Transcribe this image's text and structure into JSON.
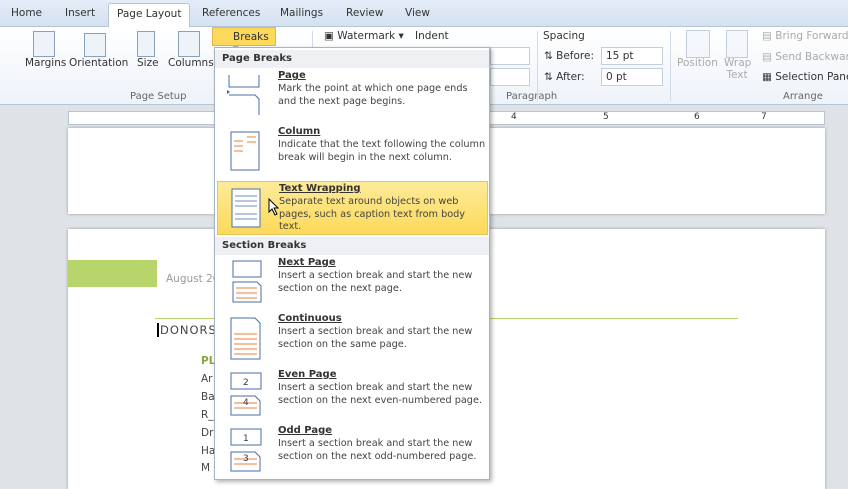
{
  "tabs": [
    "Home",
    "Insert",
    "Page Layout",
    "References",
    "Mailings",
    "Review",
    "View"
  ],
  "ribbon": {
    "margins": "Margins",
    "orientation": "Orientation",
    "size": "Size",
    "columns": "Columns",
    "page_setup": "Page Setup",
    "breaks": "Breaks",
    "watermark": "Watermark",
    "indent": "Indent",
    "spacing": "Spacing",
    "before_label": "Before:",
    "before_value": "15 pt",
    "after_label": "After:",
    "after_value": "0 pt",
    "paragraph": "Paragraph",
    "position": "Position",
    "wrap_text": "Wrap Text",
    "bring_forward": "Bring Forward",
    "send_backward": "Send Backward",
    "selection_pane": "Selection Pane",
    "arrange": "Arrange"
  },
  "ruler": [
    "4",
    "5",
    "6",
    "7"
  ],
  "menu": {
    "page_breaks": "Page Breaks",
    "section_breaks": "Section Breaks",
    "items": [
      {
        "title": "Page",
        "desc": "Mark the point at which one page ends and the next page begins."
      },
      {
        "title": "Column",
        "desc": "Indicate that the text following the column break will begin in the next column."
      },
      {
        "title": "Text Wrapping",
        "desc": "Separate text around objects on web pages, such as caption text from body text."
      },
      {
        "title": "Next Page",
        "desc": "Insert a section break and start the new section on the next page."
      },
      {
        "title": "Continuous",
        "desc": "Insert a section break and start the new section on the same page."
      },
      {
        "title": "Even Page",
        "desc": "Insert a section break and start the new section on the next even-numbered page."
      },
      {
        "title": "Odd Page",
        "desc": "Insert a section break and start the new section on the next odd-numbered page."
      }
    ]
  },
  "document": {
    "date": "August 20",
    "heading": "DONORS",
    "sub": "PL",
    "lines": [
      "Ar",
      "Ba",
      "R_",
      "Dr",
      "Ha",
      "M"
    ]
  },
  "colors": {
    "accent_green": "#b7d56b",
    "highlight": "#fcd95a"
  }
}
